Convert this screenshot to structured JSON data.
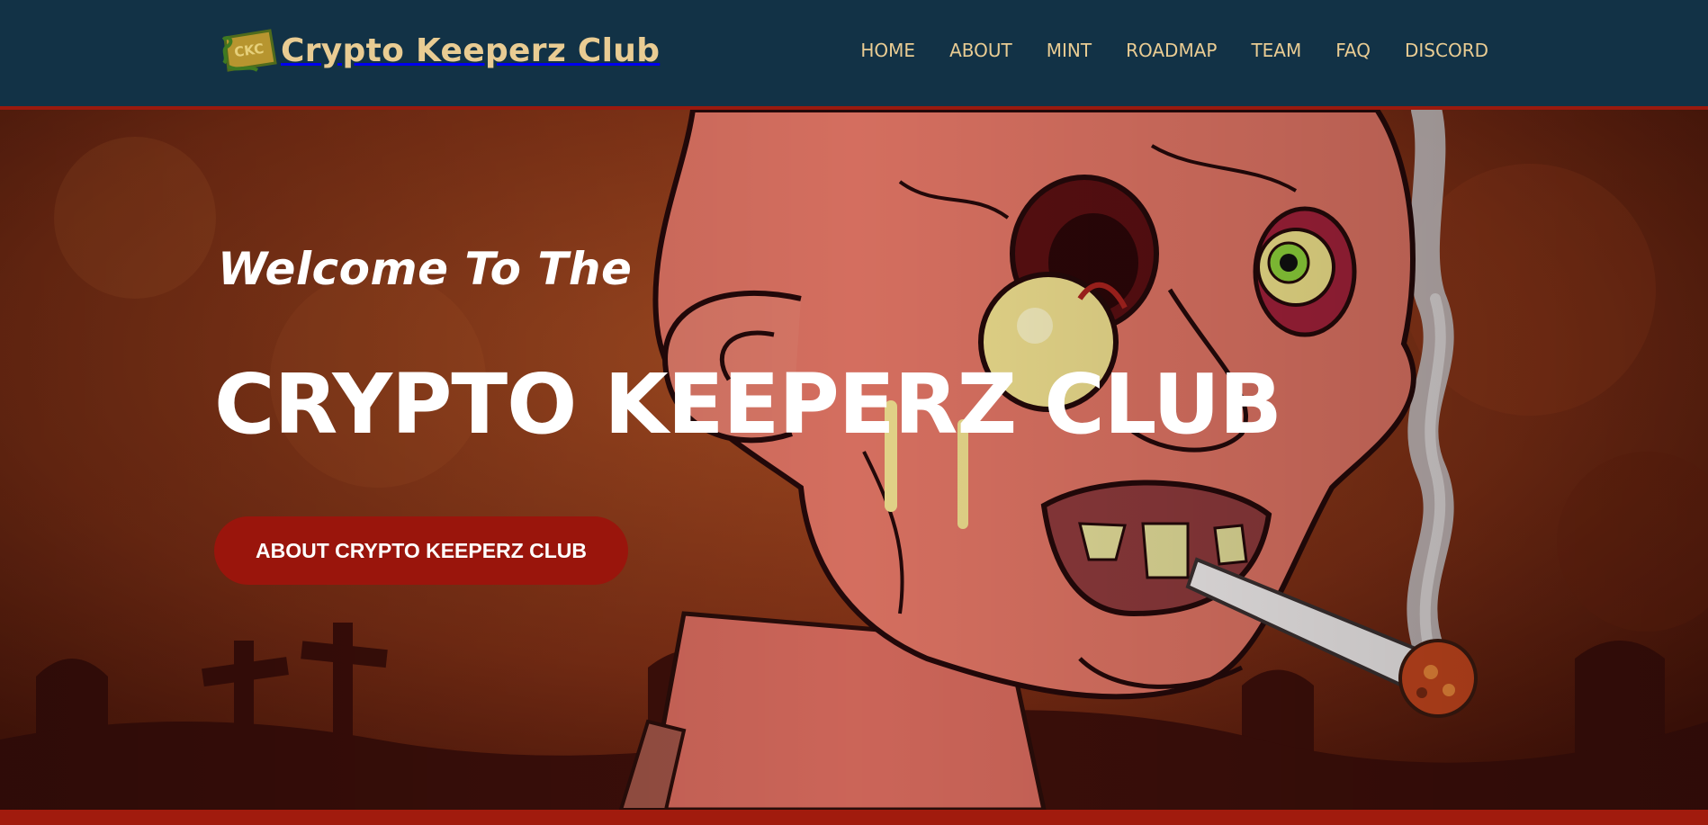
{
  "header": {
    "logo_badge_text": "CKC",
    "brand_name": "Crypto Keeperz Club",
    "nav": [
      "HOME",
      "ABOUT",
      "MINT",
      "ROADMAP",
      "TEAM",
      "FAQ",
      "DISCORD"
    ]
  },
  "hero": {
    "welcome": "Welcome To The",
    "title": "CRYPTO KEEPERZ CLUB",
    "cta_label": "ABOUT CRYPTO KEEPERZ CLUB",
    "art_icon": "zombie-smoking-graveyard-illustration"
  },
  "colors": {
    "header_bg": "#123246",
    "brand_text": "#e9cc93",
    "accent_red": "#9a150c"
  }
}
